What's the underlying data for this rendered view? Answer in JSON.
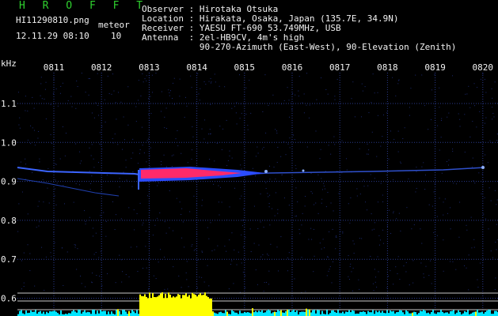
{
  "header": {
    "app_title": "H R O F F T",
    "filename": "HI11290810.png",
    "meteor_label": "meteor",
    "datetime": "12.11.29 08:10",
    "meteor_count": "10",
    "info_lines": [
      "Observer : Hirotaka Otsuka",
      "Location : Hirakata, Osaka, Japan (135.7E, 34.9N)",
      "Receiver : YAESU FT-690 53.749MHz, USB",
      "Antenna  : 2el-HB9CV, 4m's high",
      "           90-270-Azimuth (East-West), 90-Elevation (Zenith)"
    ]
  },
  "axis": {
    "unit": "kHz",
    "time_labels": [
      "0811",
      "0812",
      "0813",
      "0814",
      "0815",
      "0816",
      "0817",
      "0818",
      "0819",
      "0820"
    ],
    "freq_labels": [
      "1.1",
      "1.0",
      "0.9",
      "0.8",
      "0.7",
      "0.6"
    ]
  },
  "colors": {
    "background": "#000000",
    "text_green": "#2fd12f",
    "text_white": "#f2f2f2",
    "grid": "#2a3a8c",
    "signal_blue": "#3b64ff",
    "signal_hot": "#ff2a6a",
    "level_bars": "#00e5ff",
    "level_burst": "#ffff00",
    "level_lines": "#c8c8c8"
  }
}
